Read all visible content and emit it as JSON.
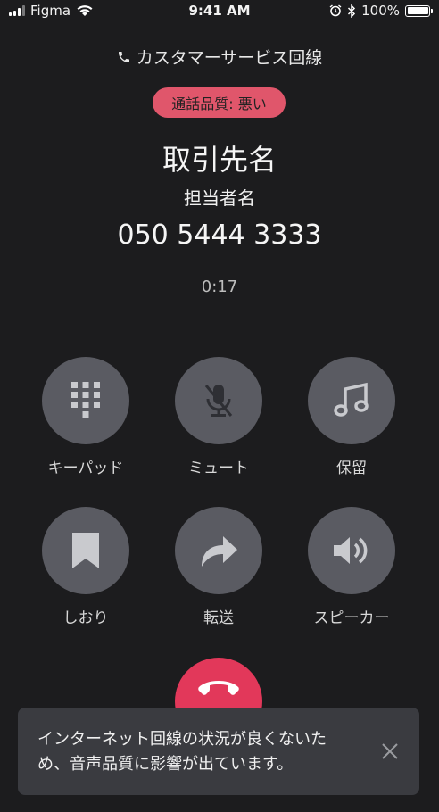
{
  "status_bar": {
    "carrier": "Figma",
    "time": "9:41 AM",
    "battery_percent": "100%",
    "battery_level": 1.0
  },
  "call": {
    "line_name": "カスタマーサービス回線",
    "quality_badge": "通話品質: 悪い",
    "contact_name": "取引先名",
    "person_name": "担当者名",
    "phone_number": "050 5444 3333",
    "duration": "0:17"
  },
  "controls": [
    {
      "label": "キーパッド",
      "icon": "keypad-icon"
    },
    {
      "label": "ミュート",
      "icon": "mic-off-icon"
    },
    {
      "label": "保留",
      "icon": "music-note-icon"
    },
    {
      "label": "しおり",
      "icon": "bookmark-icon"
    },
    {
      "label": "転送",
      "icon": "share-arrow-icon"
    },
    {
      "label": "スピーカー",
      "icon": "speaker-icon"
    }
  ],
  "toast": {
    "message": "インターネット回線の状況が良くないため、音声品質に影響が出ています。"
  },
  "colors": {
    "background": "#1c1c1e",
    "button": "#5a5b62",
    "badge": "#e0566b",
    "end_call": "#e2385a",
    "toast": "#3a3b40"
  }
}
